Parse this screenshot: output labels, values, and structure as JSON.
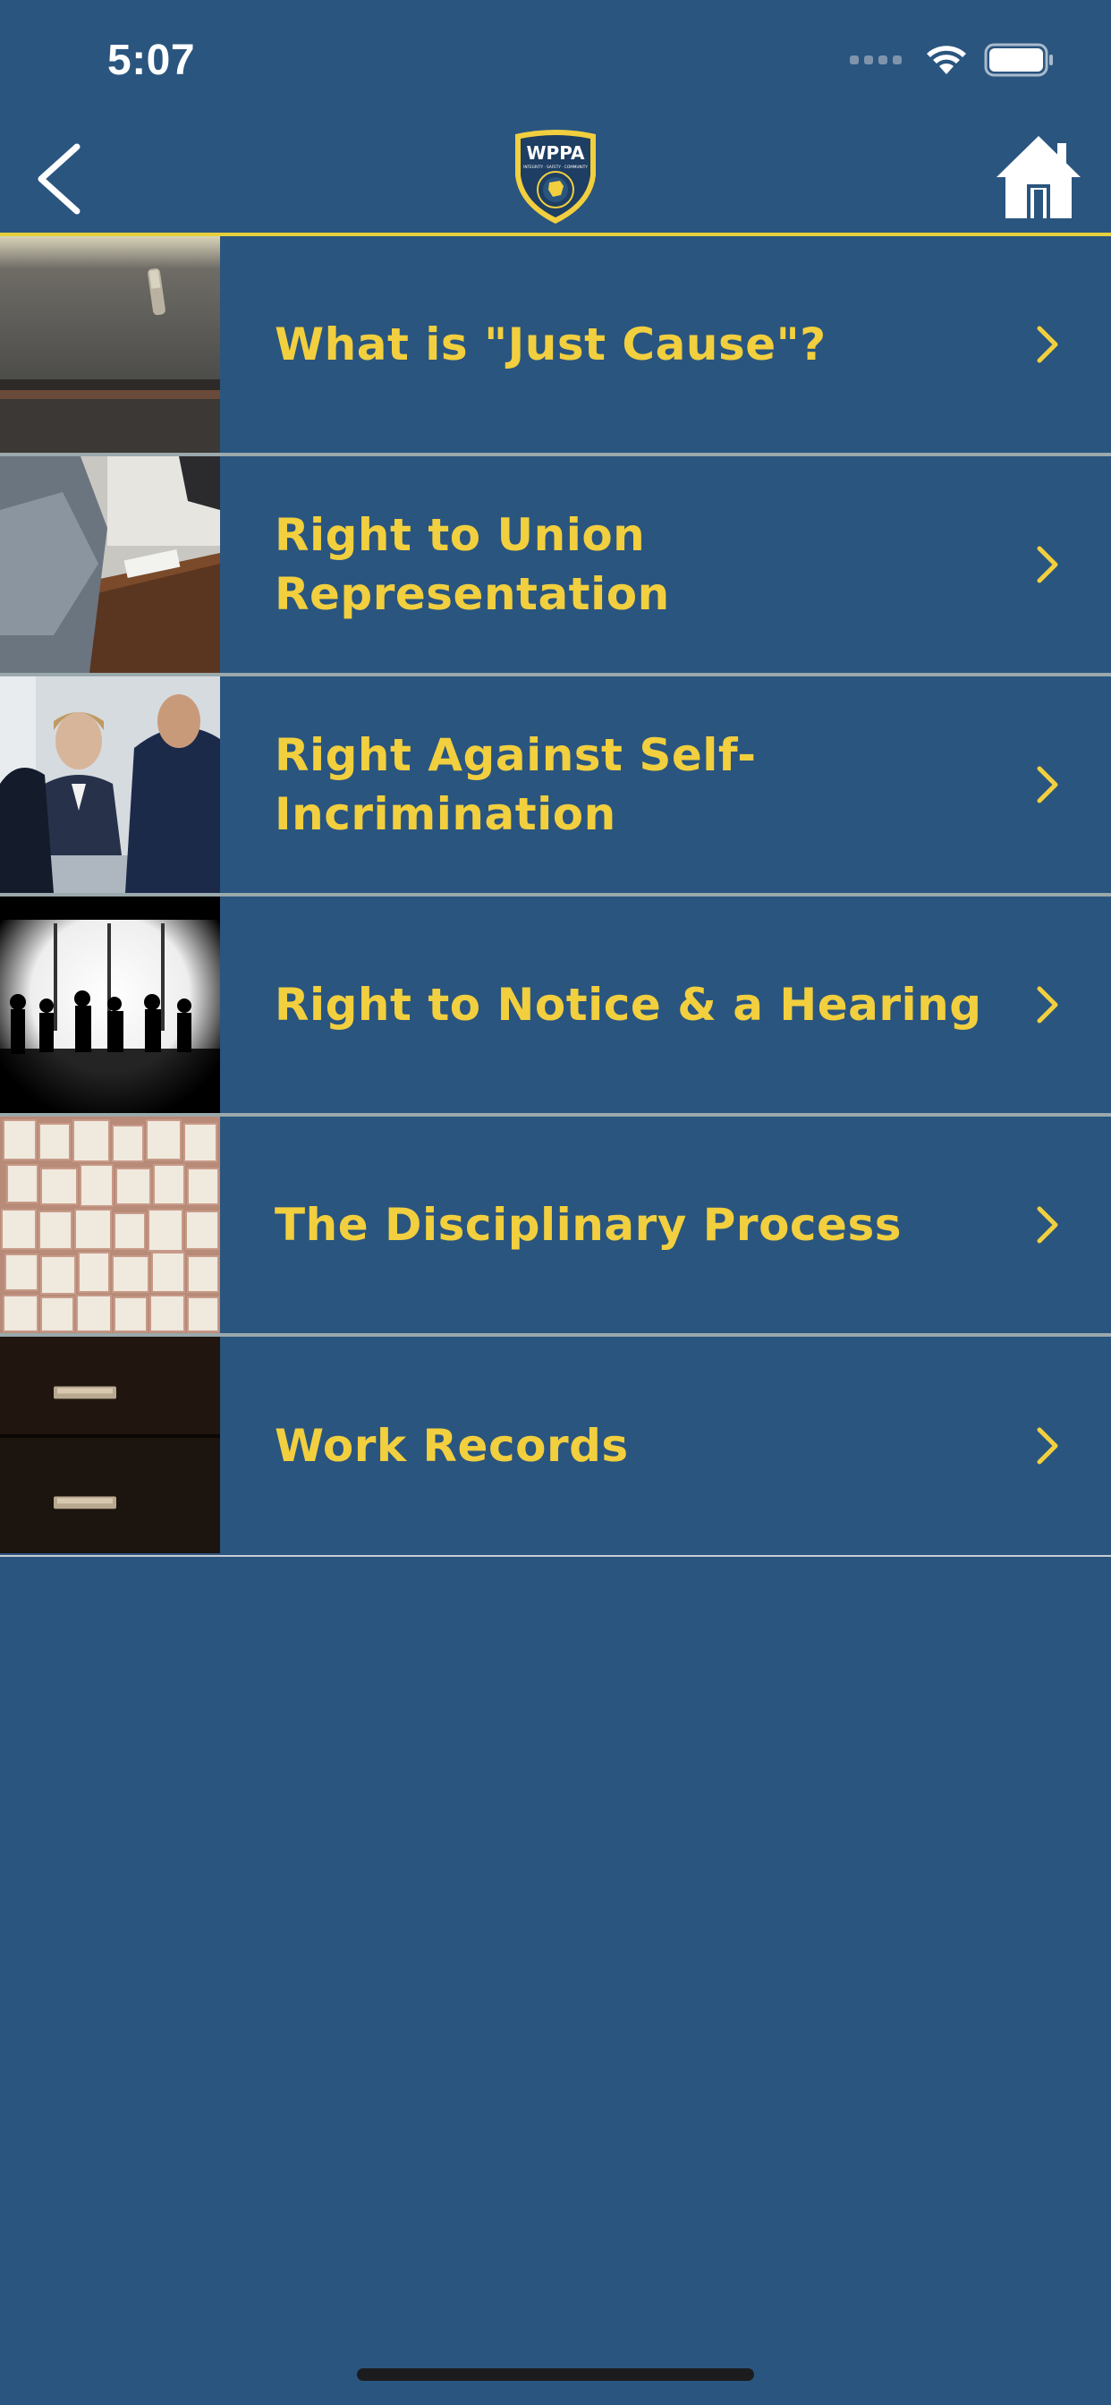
{
  "status_bar": {
    "time": "5:07"
  },
  "navbar": {
    "back_icon": "chevron-left-icon",
    "logo_text": "WPPA",
    "logo_motto": "INTEGRITY · SAFETY · COMMUNITY",
    "home_icon": "home-icon"
  },
  "colors": {
    "background": "#2a557f",
    "accent": "#f2cf3e",
    "divider": "#e7cf3d"
  },
  "menu": {
    "items": [
      {
        "label": "What is \"Just Cause\"?",
        "thumb": "pen-on-desk-photo"
      },
      {
        "label": "Right to Union Representation",
        "thumb": "people-at-table-photo"
      },
      {
        "label": "Right Against Self-Incrimination",
        "thumb": "interview-photo"
      },
      {
        "label": "Right to Notice & a Hearing",
        "thumb": "silhouettes-window-photo"
      },
      {
        "label": "The Disciplinary Process",
        "thumb": "book-pages-photo"
      },
      {
        "label": "Work Records",
        "thumb": "file-drawers-photo"
      }
    ]
  }
}
